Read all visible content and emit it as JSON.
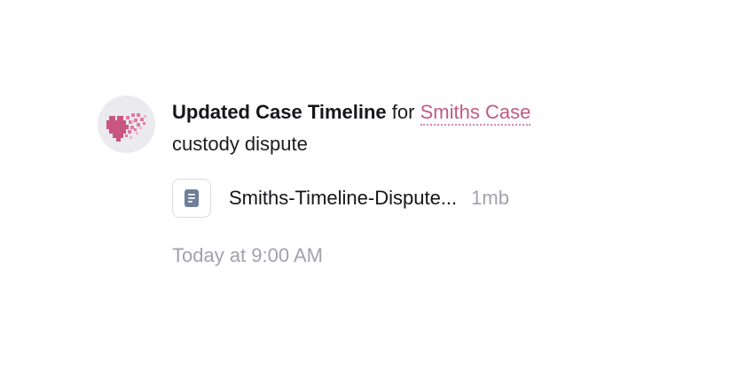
{
  "notification": {
    "action": "Updated Case Timeline",
    "connector": "for",
    "case_name": "Smiths Case",
    "description": "custody dispute",
    "attachment": {
      "icon": "document-icon",
      "name": "Smiths-Timeline-Dispute...",
      "size": "1mb"
    },
    "timestamp": "Today at 9:00 AM",
    "avatar_icon": "pixel-heart-icon"
  },
  "colors": {
    "accent": "#c05a84",
    "avatar_bg": "#ebeaee",
    "muted_text": "#a3a1ab"
  }
}
